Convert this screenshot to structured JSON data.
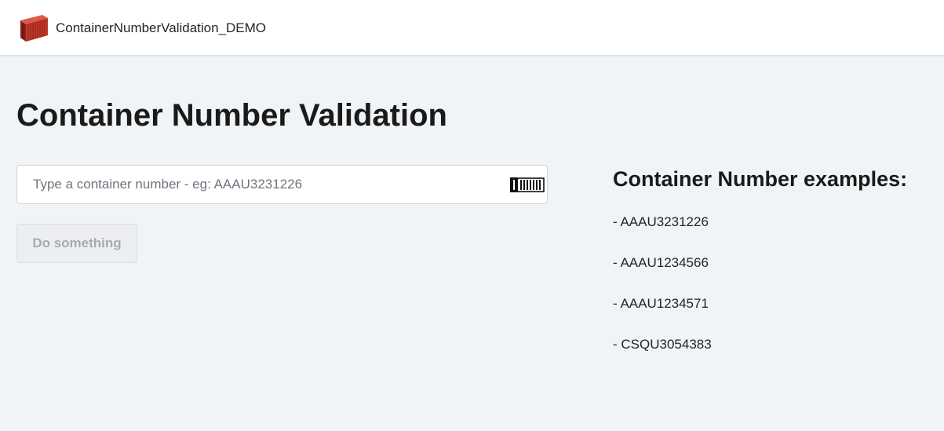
{
  "navbar": {
    "brand_name": "ContainerNumberValidation_DEMO",
    "logo_icon": "shipping-container-logo",
    "logo_color": "#c0392b"
  },
  "main": {
    "title": "Container Number Validation",
    "input": {
      "value": "",
      "placeholder": "Type a container number - eg: AAAU3231226",
      "icon": "container-icon"
    },
    "button": {
      "label": "Do something",
      "disabled": true
    }
  },
  "examples": {
    "title": "Container Number examples:",
    "items": [
      "- AAAU3231226",
      "- AAAU1234566",
      "- AAAU1234571",
      "- CSQU3054383"
    ]
  }
}
